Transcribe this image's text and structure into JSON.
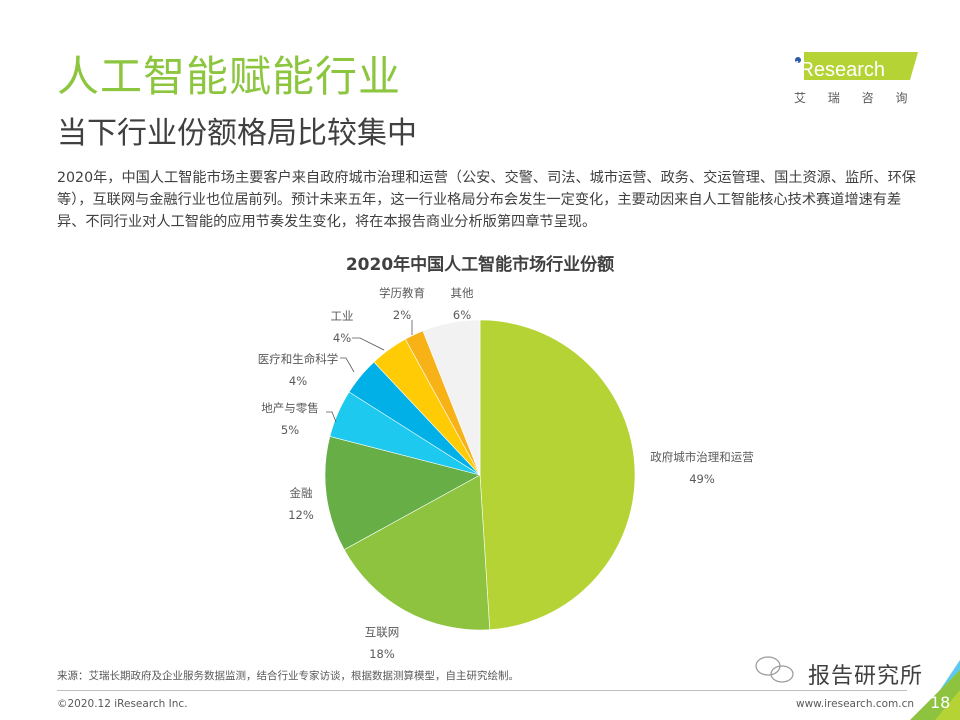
{
  "header": {
    "title": "人工智能赋能行业",
    "subtitle": "当下行业份额格局比较集中"
  },
  "logo": {
    "brand": "iResearch",
    "brand_cn": "艾 瑞 咨 询",
    "accent": "#b5d334",
    "dot_color": "#2b5aa8"
  },
  "description": "2020年，中国人工智能市场主要客户来自政府城市治理和运营（公安、交警、司法、城市运营、政务、交运管理、国土资源、监所、环保等），互联网与金融行业也位居前列。预计未来五年，这一行业格局分布会发生一定变化，主要动因来自人工智能核心技术赛道增速有差异、不同行业对人工智能的应用节奏发生变化，将在本报告商业分析版第四章节呈现。",
  "chart_data": {
    "type": "pie",
    "title": "2020年中国人工智能市场行业份额",
    "unit": "%",
    "start": "12 o'clock",
    "direction": "clockwise",
    "slices": [
      {
        "label": "政府城市治理和运营",
        "value": 49,
        "pct": "49%",
        "color": "#b5d334"
      },
      {
        "label": "互联网",
        "value": 18,
        "pct": "18%",
        "color": "#8dc33f"
      },
      {
        "label": "金融",
        "value": 12,
        "pct": "12%",
        "color": "#66ae45"
      },
      {
        "label": "地产与零售",
        "value": 5,
        "pct": "5%",
        "color": "#1ec9f0"
      },
      {
        "label": "医疗和生命科学",
        "value": 4,
        "pct": "4%",
        "color": "#00b0e6"
      },
      {
        "label": "工业",
        "value": 4,
        "pct": "4%",
        "color": "#ffcb05"
      },
      {
        "label": "学历教育",
        "value": 2,
        "pct": "2%",
        "color": "#f7b217"
      },
      {
        "label": "其他",
        "value": 6,
        "pct": "6%",
        "color": "#f2f2f2"
      }
    ]
  },
  "footer": {
    "source": "来源：艾瑞长期政府及企业服务数据监测，结合行业专家访谈，根据数据测算模型，自主研究绘制。",
    "copyright": "©2020.12 iResearch Inc.",
    "website": "www.iresearch.com.cn",
    "page_number": "18",
    "watermark": "报告研究所"
  }
}
